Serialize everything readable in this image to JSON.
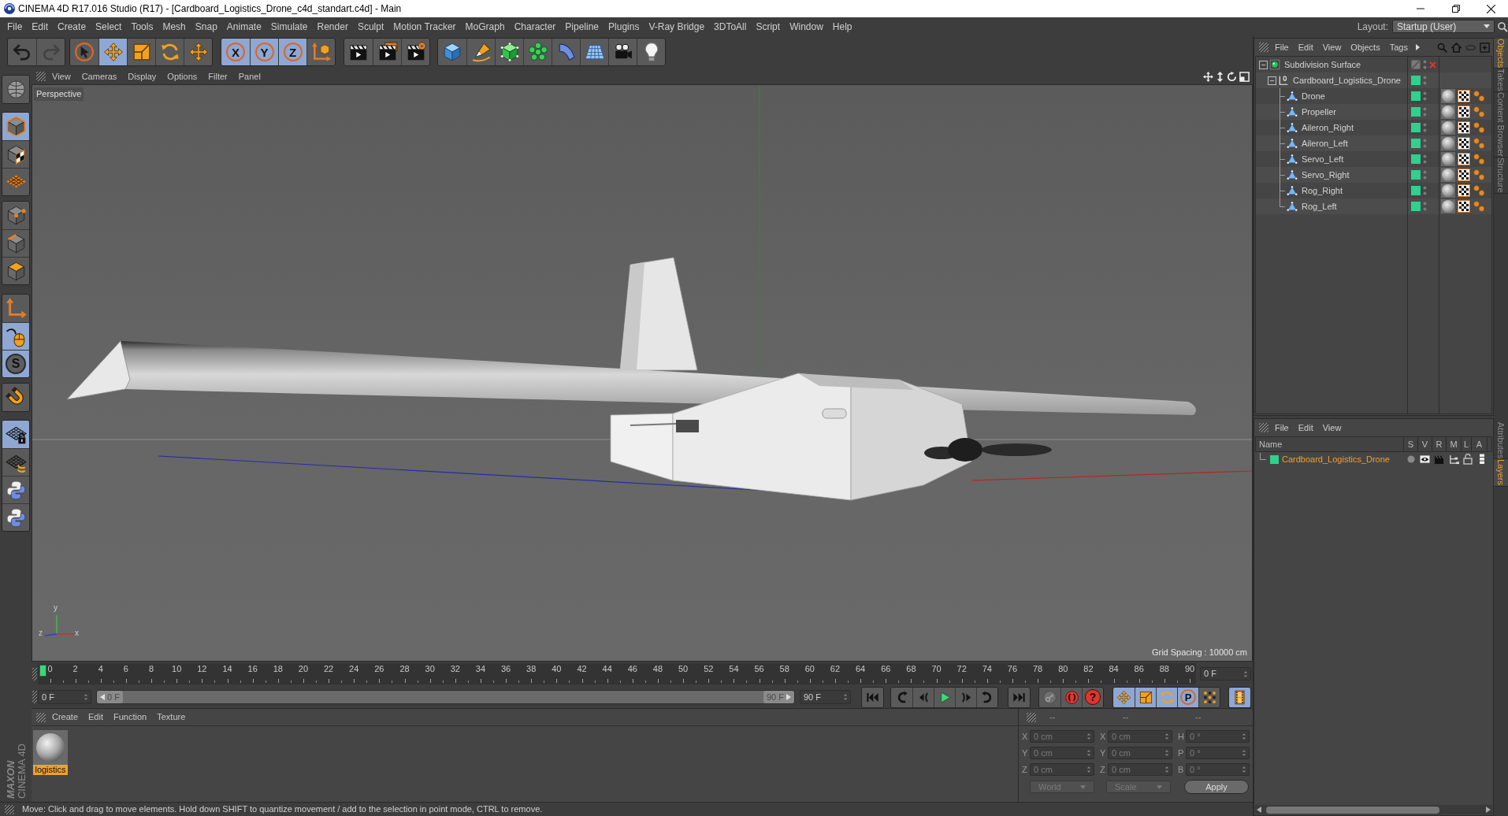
{
  "window": {
    "title": "CINEMA 4D R17.016 Studio (R17) - [Cardboard_Logistics_Drone_c4d_standart.c4d] - Main"
  },
  "menu_bar": {
    "items": [
      "File",
      "Edit",
      "Create",
      "Select",
      "Tools",
      "Mesh",
      "Snap",
      "Animate",
      "Simulate",
      "Render",
      "Sculpt",
      "Motion Tracker",
      "MoGraph",
      "Character",
      "Pipeline",
      "Plugins",
      "V-Ray Bridge",
      "3DToAll",
      "Script",
      "Window",
      "Help"
    ],
    "layout_label": "Layout:",
    "layout_value": "Startup (User)"
  },
  "toolbar": {
    "groups": [
      {
        "tools": [
          {
            "kind": "undo",
            "disabled": false
          },
          {
            "kind": "redo",
            "disabled": true
          }
        ]
      },
      {
        "tools": [
          {
            "kind": "select",
            "selected": false
          },
          {
            "kind": "move",
            "selected": true
          },
          {
            "kind": "scale",
            "selected": false
          },
          {
            "kind": "rotate",
            "selected": false
          },
          {
            "kind": "transform",
            "selected": false
          }
        ]
      },
      {
        "tools": [
          {
            "kind": "axis",
            "label": "X",
            "selected": true
          },
          {
            "kind": "axis",
            "label": "Y",
            "selected": true
          },
          {
            "kind": "axis",
            "label": "Z",
            "selected": true
          },
          {
            "kind": "coordinates",
            "selected": false
          }
        ]
      },
      {
        "tools": [
          {
            "kind": "render"
          },
          {
            "kind": "viewer"
          },
          {
            "kind": "settings"
          }
        ]
      },
      {
        "tools": [
          {
            "kind": "cube"
          },
          {
            "kind": "pen"
          },
          {
            "kind": "subdivision"
          },
          {
            "kind": "cloner"
          },
          {
            "kind": "deformer"
          },
          {
            "kind": "floor"
          },
          {
            "kind": "camera"
          },
          {
            "kind": "light"
          }
        ]
      }
    ]
  },
  "side_toolbar": {
    "groups": [
      {
        "tools": [
          {
            "kind": "editable"
          }
        ]
      },
      {
        "tools": [
          {
            "kind": "model",
            "selected": true
          },
          {
            "kind": "texture",
            "selected": false
          },
          {
            "kind": "workplane",
            "selected": false
          }
        ]
      },
      {
        "tools": [
          {
            "kind": "points",
            "selected": false
          },
          {
            "kind": "edges",
            "selected": false
          },
          {
            "kind": "polygons",
            "selected": false
          }
        ]
      },
      {
        "tools": [
          {
            "kind": "objectaxis",
            "selected": false
          },
          {
            "kind": "tweak",
            "selected": true
          },
          {
            "kind": "snap",
            "label": "S",
            "selected": true
          }
        ]
      },
      {
        "tools": [
          {
            "kind": "magnet",
            "selected": false
          }
        ]
      },
      {
        "tools": [
          {
            "kind": "lockplane",
            "selected": true
          },
          {
            "kind": "planerotate",
            "selected": false
          },
          {
            "kind": "python",
            "selected": false
          },
          {
            "kind": "python",
            "selected": false
          }
        ]
      }
    ]
  },
  "logo": {
    "brand": "MAXON",
    "product": "CINEMA 4D"
  },
  "viewport": {
    "menu": [
      "View",
      "Cameras",
      "Display",
      "Options",
      "Filter",
      "Panel"
    ],
    "camera": "Perspective",
    "grid_spacing": "Grid Spacing : 10000 cm",
    "axis_labels": [
      "y",
      "x",
      "z"
    ]
  },
  "timeline": {
    "ticks": [
      "0",
      "2",
      "4",
      "6",
      "8",
      "10",
      "12",
      "14",
      "16",
      "18",
      "20",
      "22",
      "24",
      "26",
      "28",
      "30",
      "32",
      "34",
      "36",
      "38",
      "40",
      "42",
      "44",
      "46",
      "48",
      "50",
      "52",
      "54",
      "56",
      "58",
      "60",
      "62",
      "64",
      "66",
      "68",
      "70",
      "72",
      "74",
      "76",
      "78",
      "80",
      "82",
      "84",
      "86",
      "88",
      "90"
    ],
    "playhead": {
      "level": 0
    },
    "current_frame": "0 F"
  },
  "playback": {
    "start_field": "0 F",
    "range": {
      "start": "0 F",
      "end": "90 F",
      "level": 1
    },
    "end_field": "90 F",
    "groups": [
      {
        "tools": [
          {
            "kind": "first"
          }
        ]
      },
      {
        "tools": [
          {
            "kind": "prevkey"
          },
          {
            "kind": "prevframe"
          },
          {
            "kind": "play"
          },
          {
            "kind": "nextframe"
          },
          {
            "kind": "nextkey"
          }
        ]
      },
      {
        "tools": [
          {
            "kind": "last"
          }
        ]
      },
      {
        "tools": [
          {
            "kind": "keyframe"
          },
          {
            "kind": "record"
          },
          {
            "kind": "autokey",
            "label": "?"
          }
        ]
      },
      {
        "tools": [
          {
            "kind": "move",
            "selected": true
          },
          {
            "kind": "scale",
            "selected": true
          },
          {
            "kind": "rotate",
            "selected": true
          },
          {
            "kind": "param",
            "label": "P",
            "selected": true
          },
          {
            "kind": "pla",
            "selected": false
          }
        ]
      },
      {
        "tools": [
          {
            "kind": "timeline",
            "selected": true
          }
        ]
      }
    ]
  },
  "materials": {
    "menu": [
      "Create",
      "Edit",
      "Function",
      "Texture"
    ],
    "items": [
      {
        "name": "logistics",
        "selected": true
      }
    ]
  },
  "coordinates": {
    "headers": [
      "--",
      "--",
      "--"
    ],
    "rows": [
      {
        "position_axis": "X",
        "position": "0 cm",
        "size_axis": "X",
        "size": "0 cm",
        "rotation_axis": "H",
        "rotation": "0 °"
      },
      {
        "position_axis": "Y",
        "position": "0 cm",
        "size_axis": "Y",
        "size": "0 cm",
        "rotation_axis": "P",
        "rotation": "0 °"
      },
      {
        "position_axis": "Z",
        "position": "0 cm",
        "size_axis": "Z",
        "size": "0 cm",
        "rotation_axis": "B",
        "rotation": "0 °"
      }
    ],
    "dropdowns": [
      "World",
      "Scale"
    ],
    "apply": "Apply"
  },
  "status_bar": {
    "message": "Move: Click and drag to move elements. Hold down SHIFT to quantize movement / add to the selection in point mode, CTRL to remove."
  },
  "objects": {
    "menu": [
      "File",
      "Edit",
      "View",
      "Objects",
      "Tags"
    ],
    "tree": [
      {
        "name": "Subdivision Surface",
        "kind": "subdivision",
        "expanded": true,
        "enabled": false,
        "children": [
          {
            "name": "Cardboard_Logistics_Drone",
            "kind": "null",
            "expanded": true,
            "color": "#2ed18e",
            "children": [
              {
                "name": "Drone",
                "kind": "polygon",
                "color": "#2ed18e"
              },
              {
                "name": "Propeller",
                "kind": "polygon",
                "color": "#2ed18e"
              },
              {
                "name": "Aileron_Right",
                "kind": "polygon",
                "color": "#2ed18e"
              },
              {
                "name": "Aileron_Left",
                "kind": "polygon",
                "color": "#2ed18e"
              },
              {
                "name": "Servo_Left",
                "kind": "polygon",
                "color": "#2ed18e"
              },
              {
                "name": "Servo_Right",
                "kind": "polygon",
                "color": "#2ed18e"
              },
              {
                "name": "Rog_Right",
                "kind": "polygon",
                "color": "#2ed18e"
              },
              {
                "name": "Rog_Left",
                "kind": "polygon",
                "color": "#2ed18e"
              }
            ]
          }
        ]
      }
    ]
  },
  "layers": {
    "menu": [
      "File",
      "Edit",
      "View"
    ],
    "columns": [
      "Name",
      "S",
      "V",
      "R",
      "M",
      "L",
      "A"
    ],
    "rows": [
      {
        "name": "Cardboard_Logistics_Drone",
        "color": "#2ed18e"
      }
    ]
  },
  "side_tabs": {
    "upper": [
      {
        "label": "Objects",
        "selected": true
      },
      {
        "label": "Takes",
        "selected": false
      },
      {
        "label": "Content Browser",
        "selected": false
      },
      {
        "label": "Structure",
        "selected": false
      }
    ],
    "lower": [
      {
        "label": "Attributes",
        "selected": false
      },
      {
        "label": "Layers",
        "selected": true
      }
    ]
  }
}
